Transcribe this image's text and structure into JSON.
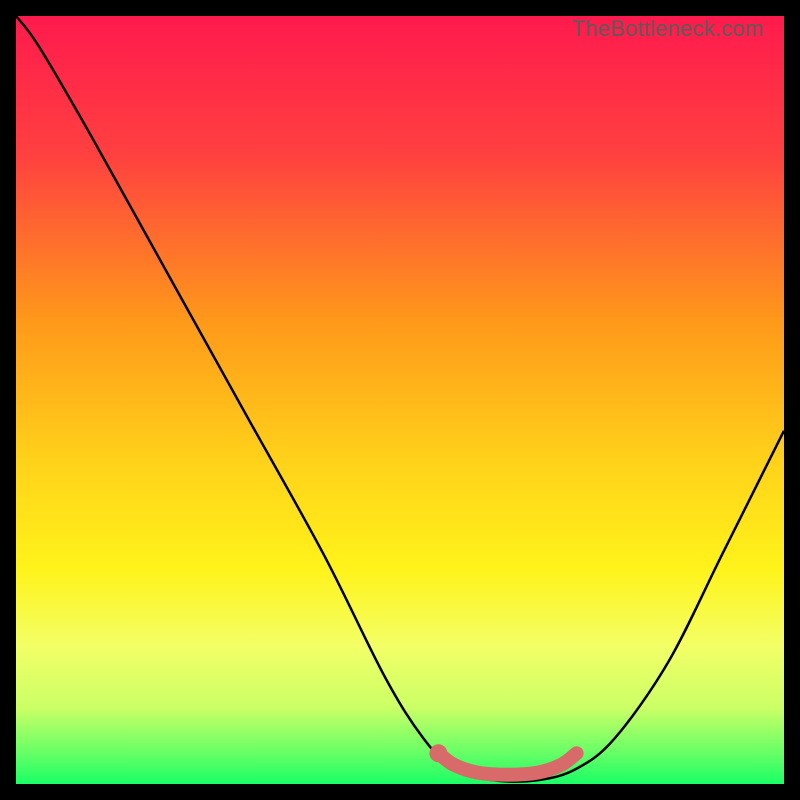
{
  "watermark": "TheBottleneck.com",
  "chart_data": {
    "type": "line",
    "title": "",
    "xlabel": "",
    "ylabel": "",
    "xlim": [
      0,
      100
    ],
    "ylim": [
      0,
      100
    ],
    "gradient_stops": [
      {
        "offset": 0,
        "color": "#ff1a4d"
      },
      {
        "offset": 18,
        "color": "#ff4040"
      },
      {
        "offset": 40,
        "color": "#ff9a1a"
      },
      {
        "offset": 58,
        "color": "#ffd21a"
      },
      {
        "offset": 72,
        "color": "#fff31a"
      },
      {
        "offset": 82,
        "color": "#f3ff66"
      },
      {
        "offset": 90,
        "color": "#ccff66"
      },
      {
        "offset": 96,
        "color": "#66ff66"
      },
      {
        "offset": 100,
        "color": "#1aff66"
      }
    ],
    "series": [
      {
        "name": "bottleneck-curve",
        "points": [
          {
            "x": 0,
            "y": 100
          },
          {
            "x": 3,
            "y": 96
          },
          {
            "x": 10,
            "y": 84
          },
          {
            "x": 20,
            "y": 66
          },
          {
            "x": 30,
            "y": 48
          },
          {
            "x": 40,
            "y": 30
          },
          {
            "x": 48,
            "y": 14
          },
          {
            "x": 53,
            "y": 6
          },
          {
            "x": 57,
            "y": 2
          },
          {
            "x": 62,
            "y": 0.5
          },
          {
            "x": 68,
            "y": 0.5
          },
          {
            "x": 73,
            "y": 2
          },
          {
            "x": 78,
            "y": 6
          },
          {
            "x": 85,
            "y": 16
          },
          {
            "x": 92,
            "y": 30
          },
          {
            "x": 100,
            "y": 46
          }
        ]
      },
      {
        "name": "optimal-marker",
        "points": [
          {
            "x": 55,
            "y": 4
          },
          {
            "x": 57,
            "y": 2.5
          },
          {
            "x": 60,
            "y": 1.5
          },
          {
            "x": 64,
            "y": 1.2
          },
          {
            "x": 68,
            "y": 1.5
          },
          {
            "x": 71,
            "y": 2.5
          },
          {
            "x": 73,
            "y": 4
          }
        ]
      }
    ],
    "marker_dot": {
      "x": 55,
      "y": 4
    }
  }
}
